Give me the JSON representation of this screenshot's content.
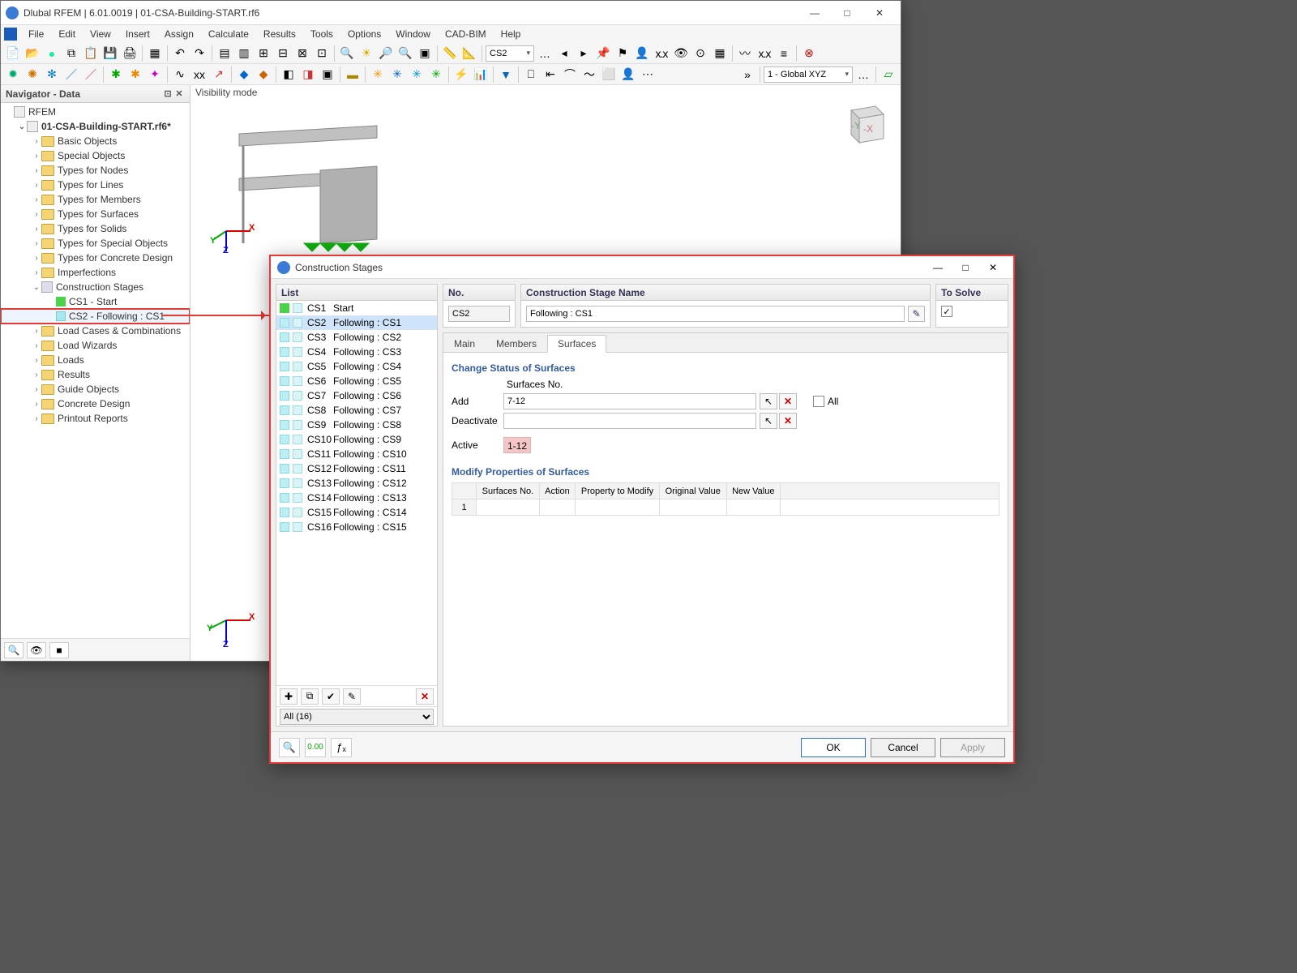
{
  "titlebar": {
    "title": "Dlubal RFEM | 6.01.0019 | 01-CSA-Building-START.rf6"
  },
  "menubar": [
    "File",
    "Edit",
    "View",
    "Insert",
    "Assign",
    "Calculate",
    "Results",
    "Tools",
    "Options",
    "Window",
    "CAD-BIM",
    "Help"
  ],
  "toolbar": {
    "combo_cs": "CS2",
    "combo_coord": "1 - Global XYZ"
  },
  "navigator": {
    "title": "Navigator - Data",
    "root": "RFEM",
    "project": "01-CSA-Building-START.rf6*",
    "folders": [
      "Basic Objects",
      "Special Objects",
      "Types for Nodes",
      "Types for Lines",
      "Types for Members",
      "Types for Surfaces",
      "Types for Solids",
      "Types for Special Objects",
      "Types for Concrete Design",
      "Imperfections"
    ],
    "cs_node": "Construction Stages",
    "cs_children": [
      {
        "icon": "green",
        "label": "CS1 - Start"
      },
      {
        "icon": "cyan",
        "label": "CS2 - Following : CS1"
      }
    ],
    "folders_after": [
      "Load Cases & Combinations",
      "Load Wizards",
      "Loads",
      "Results",
      "Guide Objects",
      "Concrete Design",
      "Printout Reports"
    ]
  },
  "viewport": {
    "vis_label": "Visibility mode"
  },
  "dialog": {
    "title": "Construction Stages",
    "list_header": "List",
    "list": [
      {
        "swatch": "green",
        "num": "CS1",
        "name": "Start"
      },
      {
        "swatch": "cyan",
        "num": "CS2",
        "name": "Following : CS1"
      },
      {
        "swatch": "cyan",
        "num": "CS3",
        "name": "Following : CS2"
      },
      {
        "swatch": "cyan",
        "num": "CS4",
        "name": "Following : CS3"
      },
      {
        "swatch": "cyan",
        "num": "CS5",
        "name": "Following : CS4"
      },
      {
        "swatch": "cyan",
        "num": "CS6",
        "name": "Following : CS5"
      },
      {
        "swatch": "cyan",
        "num": "CS7",
        "name": "Following : CS6"
      },
      {
        "swatch": "cyan",
        "num": "CS8",
        "name": "Following : CS7"
      },
      {
        "swatch": "cyan",
        "num": "CS9",
        "name": "Following : CS8"
      },
      {
        "swatch": "cyan",
        "num": "CS10",
        "name": "Following : CS9"
      },
      {
        "swatch": "cyan",
        "num": "CS11",
        "name": "Following : CS10"
      },
      {
        "swatch": "cyan",
        "num": "CS12",
        "name": "Following : CS11"
      },
      {
        "swatch": "cyan",
        "num": "CS13",
        "name": "Following : CS12"
      },
      {
        "swatch": "cyan",
        "num": "CS14",
        "name": "Following : CS13"
      },
      {
        "swatch": "cyan",
        "num": "CS15",
        "name": "Following : CS14"
      },
      {
        "swatch": "cyan",
        "num": "CS16",
        "name": "Following : CS15"
      }
    ],
    "list_selected_index": 1,
    "list_filter": "All (16)",
    "no_label": "No.",
    "no_value": "CS2",
    "name_label": "Construction Stage Name",
    "name_value": "Following : CS1",
    "solve_label": "To Solve",
    "solve_checked": true,
    "tabs": [
      "Main",
      "Members",
      "Surfaces"
    ],
    "active_tab": 2,
    "surfaces": {
      "section1": "Change Status of Surfaces",
      "col_header": "Surfaces No.",
      "rows": {
        "add_label": "Add",
        "add_value": "7-12",
        "deact_label": "Deactivate",
        "deact_value": "",
        "active_label": "Active",
        "active_value": "1-12"
      },
      "all_label": "All",
      "section2": "Modify Properties of Surfaces",
      "columns": [
        "Surfaces No.",
        "Action",
        "Property to Modify",
        "Original Value",
        "New Value"
      ]
    },
    "buttons": {
      "ok": "OK",
      "cancel": "Cancel",
      "apply": "Apply"
    }
  }
}
